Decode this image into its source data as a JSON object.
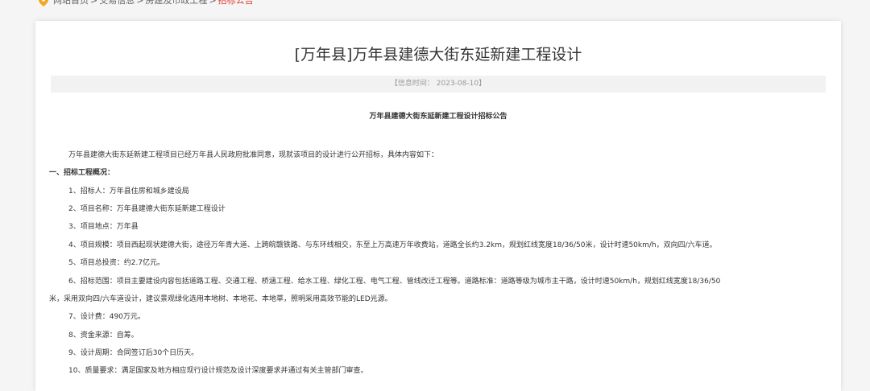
{
  "breadcrumb": {
    "items": [
      "网站首页",
      "交易信息",
      "房建及市政工程"
    ],
    "current": "招标公告",
    "separator": ">"
  },
  "article": {
    "title": "[万年县]万年县建德大街东延新建工程设计",
    "info_time": "【信息时间： 2023-08-10】",
    "subtitle": "万年县建德大街东延新建工程设计招标公告",
    "intro": "万年县建德大街东延新建工程项目已经万年县人民政府批准同意，现就该项目的设计进行公开招标，具体内容如下：",
    "section1_heading": "一、招标工程概况：",
    "items": [
      "1、招标人：万年县住房和城乡建设局",
      "2、项目名称：万年县建德大街东延新建工程设计",
      "3、项目地点：万年县",
      "4、项目规模：项目西起现状建德大街，途径万年青大道、上跨皖赣铁路、与东环线相交，东至上万高速万年收费站，道路全长约3.2km，规划红线宽度18/36/50米，设计时速50km/h，双向四/六车道。",
      "5、项目总投资：约2.7亿元。",
      "6、招标范围：项目主要建设内容包括道路工程、交通工程、桥涵工程、给水工程、绿化工程、电气工程、管线改迁工程等。道路标准：道路等级为城市主干路，设计时速50km/h，规划红线宽度18/36/50",
      "米，采用双向四/六车道设计，建议景观绿化选用本地树、本地花、本地草，照明采用高效节能的LED光源。",
      "7、设计费：490万元。",
      "8、资金来源：自筹。",
      "9、设计周期：合同签订后30个日历天。",
      "10、质量要求：满足国家及地方相应现行设计规范及设计深度要求并通过有关主管部门审查。"
    ]
  },
  "colors": {
    "accent": "#e03c2e",
    "pin": "#f5a623",
    "background": "#f5f5f5",
    "infobar": "#f2f2f2"
  },
  "icons": {
    "breadcrumb": "location-pin-icon"
  }
}
